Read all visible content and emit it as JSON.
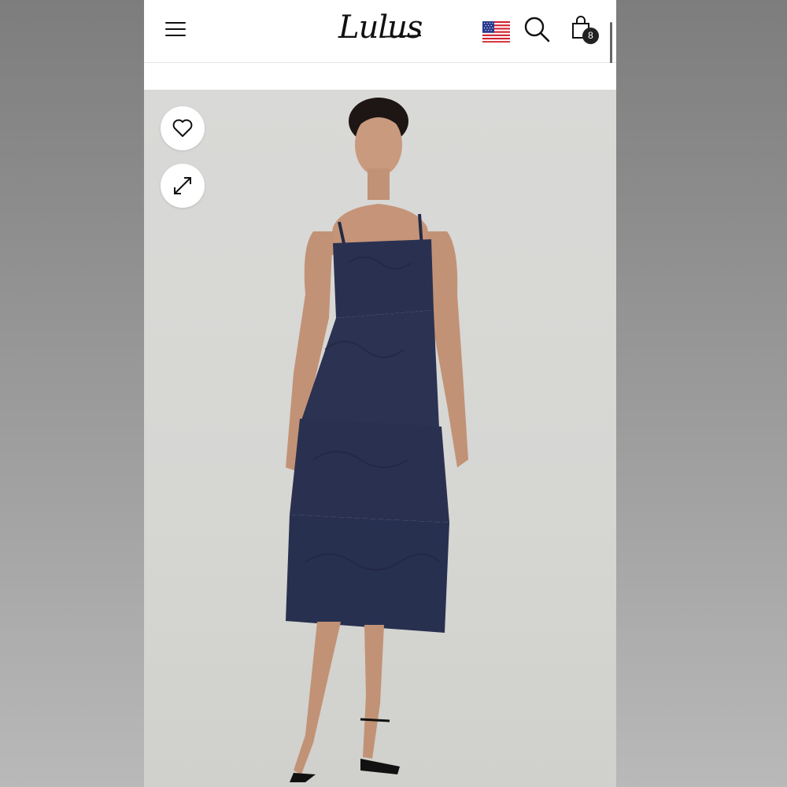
{
  "header": {
    "logo_text": "Lulus",
    "cart_count": "8"
  },
  "icons": {
    "menu": "menu-icon",
    "flag": "us-flag-icon",
    "search": "search-icon",
    "bag": "shopping-bag-icon",
    "favorite": "heart-icon",
    "expand": "expand-icon"
  },
  "product_image": {
    "description_hidden": true
  },
  "colors": {
    "dress": "#2a3150",
    "background": "#d8d8d5"
  }
}
